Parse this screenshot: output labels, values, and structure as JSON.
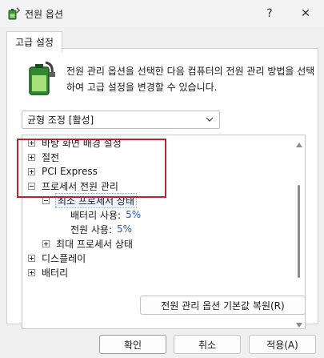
{
  "window": {
    "title": "전원 옵션",
    "help_glyph": "?",
    "close_glyph": "✕"
  },
  "tab": {
    "label": "고급 설정"
  },
  "description": "전원 관리 옵션을 선택한 다음 컴퓨터의 전원 관리 방법을 선택하여 고급 설정을 변경할 수 있습니다.",
  "plan_select": {
    "value": "균형 조정 [활성]"
  },
  "tree": {
    "items": [
      {
        "label": "바탕 화면 배경 설정"
      },
      {
        "label": "절전"
      },
      {
        "label": "PCI Express"
      },
      {
        "label": "프로세서 전원 관리"
      },
      {
        "label": "최소 프로세서 상태"
      },
      {
        "label": "배터리 사용:",
        "value": "5%"
      },
      {
        "label": "전원 사용:",
        "value": "5%"
      },
      {
        "label": "최대 프로세서 상태"
      },
      {
        "label": "디스플레이"
      },
      {
        "label": "배터리"
      }
    ]
  },
  "buttons": {
    "restore": "전원 관리 옵션 기본값 복원(R)",
    "ok": "확인",
    "cancel": "취소",
    "apply": "적용(A)"
  },
  "colors": {
    "highlight_border": "#c0222a",
    "value_text": "#1e5fbf",
    "selection_bg": "#eaf3ff"
  },
  "icons": [
    "power-options-icon",
    "battery-power-icon",
    "chevron-down-icon",
    "tree-expand-icon",
    "tree-collapse-icon",
    "scroll-up-arrow-icon",
    "scroll-down-arrow-icon"
  ]
}
